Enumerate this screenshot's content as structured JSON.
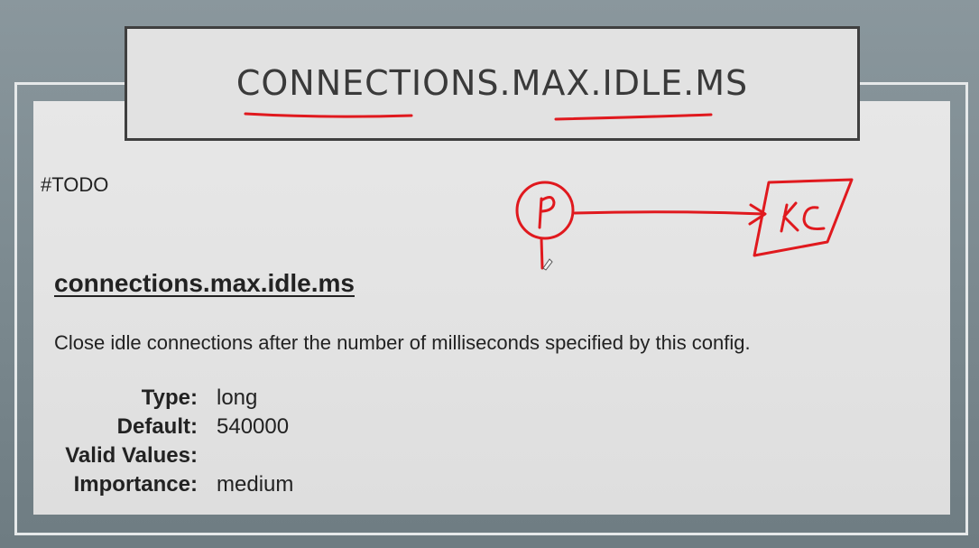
{
  "slide": {
    "title": "CONNECTIONS.MAX.IDLE.MS",
    "todo_note": "#TODO",
    "config": {
      "name": "connections.max.idle.ms",
      "description": "Close idle connections after the number of milliseconds specified by this config.",
      "properties": [
        {
          "label": "Type:",
          "value": "long"
        },
        {
          "label": "Default:",
          "value": "540000"
        },
        {
          "label": "Valid Values:",
          "value": ""
        },
        {
          "label": "Importance:",
          "value": "medium"
        }
      ]
    }
  },
  "annotation": {
    "color": "#e0191e",
    "producer_label": "P",
    "cluster_label": "KC"
  }
}
